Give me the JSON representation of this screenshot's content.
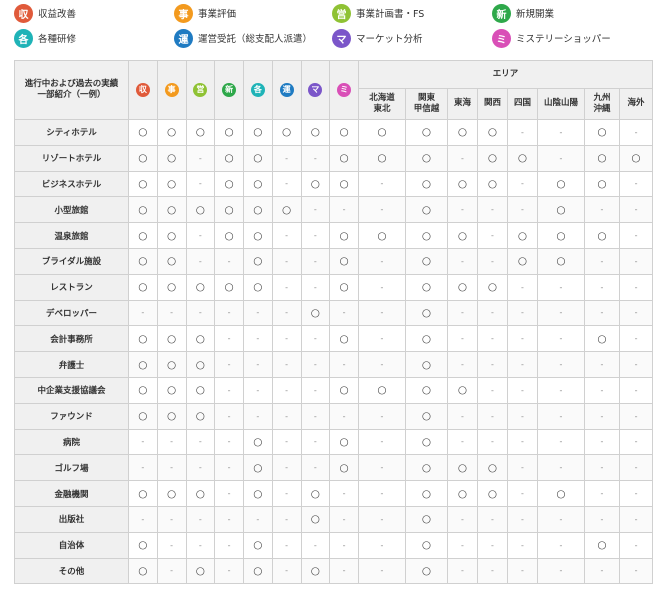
{
  "legend": [
    {
      "char": "収",
      "label": "収益改善",
      "color": "#e05a3a"
    },
    {
      "char": "事",
      "label": "事業評価",
      "color": "#f39a1e"
    },
    {
      "char": "営",
      "label": "事業計画書・FS",
      "color": "#8fc234"
    },
    {
      "char": "新",
      "label": "新規開業",
      "color": "#2ea84a"
    },
    {
      "char": "各",
      "label": "各種研修",
      "color": "#1fb3b7"
    },
    {
      "char": "運",
      "label": "運営受託（総支配人派遣）",
      "color": "#1f7bc2"
    },
    {
      "char": "マ",
      "label": "マーケット分析",
      "color": "#7b56c9"
    },
    {
      "char": "ミ",
      "label": "ミステリーショッパー",
      "color": "#d94fb7"
    }
  ],
  "table": {
    "corner": "進行中および過去の実績\n一部紹介（一例）",
    "area_header": "エリア",
    "areas": [
      "北海道\n東北",
      "関東\n甲信越",
      "東海",
      "関西",
      "四国",
      "山陰山陽",
      "九州\n沖縄",
      "海外"
    ],
    "circle": "○",
    "dash": "-",
    "rows": [
      {
        "label": "シティホテル",
        "cells": [
          1,
          1,
          1,
          1,
          1,
          1,
          1,
          1,
          1,
          1,
          1,
          1,
          0,
          0,
          1,
          0
        ]
      },
      {
        "label": "リゾートホテル",
        "cells": [
          1,
          1,
          0,
          1,
          1,
          0,
          0,
          1,
          1,
          1,
          0,
          1,
          1,
          0,
          1,
          1
        ]
      },
      {
        "label": "ビジネスホテル",
        "cells": [
          1,
          1,
          0,
          1,
          1,
          0,
          1,
          1,
          0,
          1,
          1,
          1,
          0,
          1,
          1,
          0
        ]
      },
      {
        "label": "小型旅館",
        "cells": [
          1,
          1,
          1,
          1,
          1,
          1,
          0,
          0,
          0,
          1,
          0,
          0,
          0,
          1,
          0,
          0
        ]
      },
      {
        "label": "温泉旅館",
        "cells": [
          1,
          1,
          0,
          1,
          1,
          0,
          0,
          1,
          1,
          1,
          1,
          0,
          1,
          1,
          1,
          0
        ]
      },
      {
        "label": "ブライダル施設",
        "cells": [
          1,
          1,
          0,
          0,
          1,
          0,
          0,
          1,
          0,
          1,
          0,
          0,
          1,
          1,
          0,
          0
        ]
      },
      {
        "label": "レストラン",
        "cells": [
          1,
          1,
          1,
          1,
          1,
          0,
          0,
          1,
          0,
          1,
          1,
          1,
          0,
          0,
          0,
          0
        ]
      },
      {
        "label": "デベロッパー",
        "cells": [
          0,
          0,
          0,
          0,
          0,
          0,
          1,
          0,
          0,
          1,
          0,
          0,
          0,
          0,
          0,
          0
        ]
      },
      {
        "label": "会計事務所",
        "cells": [
          1,
          1,
          1,
          0,
          0,
          0,
          0,
          1,
          0,
          1,
          0,
          0,
          0,
          0,
          1,
          0
        ]
      },
      {
        "label": "弁護士",
        "cells": [
          1,
          1,
          1,
          0,
          0,
          0,
          0,
          0,
          0,
          1,
          0,
          0,
          0,
          0,
          0,
          0
        ]
      },
      {
        "label": "中企業支援協議会",
        "cells": [
          1,
          1,
          1,
          0,
          0,
          0,
          0,
          1,
          1,
          1,
          1,
          0,
          0,
          0,
          0,
          0
        ]
      },
      {
        "label": "ファウンド",
        "cells": [
          1,
          1,
          1,
          0,
          0,
          0,
          0,
          0,
          0,
          1,
          0,
          0,
          0,
          0,
          0,
          0
        ]
      },
      {
        "label": "病院",
        "cells": [
          0,
          0,
          0,
          0,
          1,
          0,
          0,
          1,
          0,
          1,
          0,
          0,
          0,
          0,
          0,
          0
        ]
      },
      {
        "label": "ゴルフ場",
        "cells": [
          0,
          0,
          0,
          0,
          1,
          0,
          0,
          1,
          0,
          1,
          1,
          1,
          0,
          0,
          0,
          0
        ]
      },
      {
        "label": "金融機関",
        "cells": [
          1,
          1,
          1,
          0,
          1,
          0,
          1,
          0,
          0,
          1,
          1,
          1,
          0,
          1,
          0,
          0
        ]
      },
      {
        "label": "出版社",
        "cells": [
          0,
          0,
          0,
          0,
          0,
          0,
          1,
          0,
          0,
          1,
          0,
          0,
          0,
          0,
          0,
          0
        ]
      },
      {
        "label": "自治体",
        "cells": [
          1,
          0,
          0,
          0,
          1,
          0,
          0,
          0,
          0,
          1,
          0,
          0,
          0,
          0,
          1,
          0
        ]
      },
      {
        "label": "その他",
        "cells": [
          1,
          0,
          1,
          0,
          1,
          0,
          1,
          0,
          0,
          1,
          0,
          0,
          0,
          0,
          0,
          0
        ]
      }
    ]
  }
}
